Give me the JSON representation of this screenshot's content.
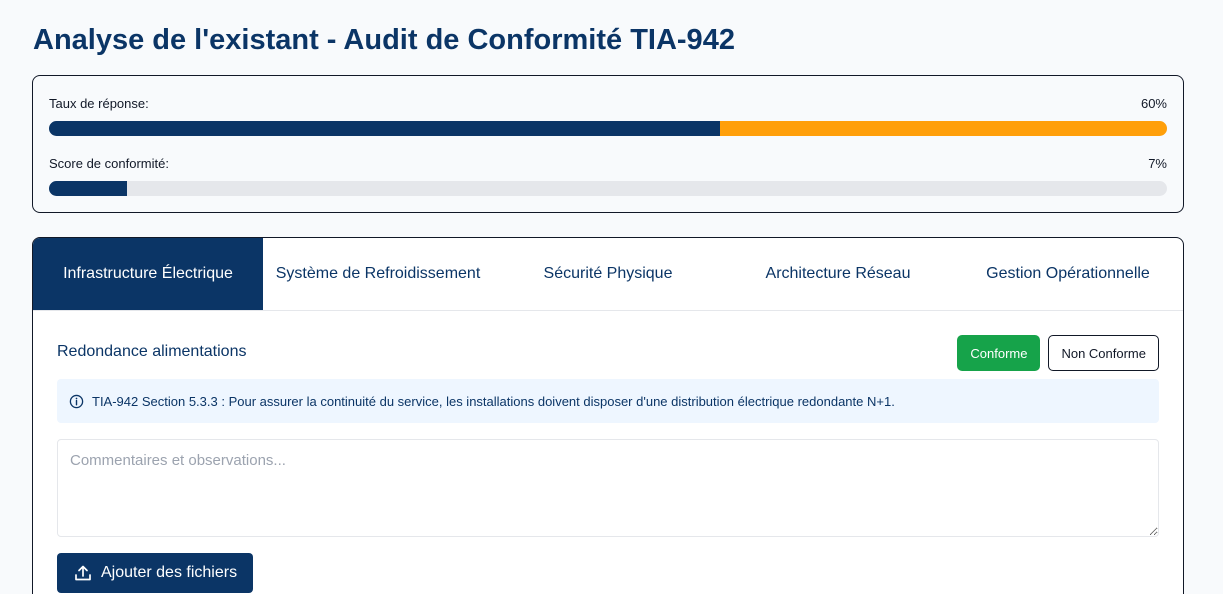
{
  "page": {
    "title": "Analyse de l'existant - Audit de Conformité TIA-942"
  },
  "stats": {
    "response_rate": {
      "label": "Taux de réponse:",
      "value_text": "60%",
      "value": 60
    },
    "compliance_score": {
      "label": "Score de conformité:",
      "value_text": "7%",
      "value": 7
    }
  },
  "tabs": [
    {
      "label": "Infrastructure Électrique",
      "active": true
    },
    {
      "label": "Système de Refroidissement",
      "active": false
    },
    {
      "label": "Sécurité Physique",
      "active": false
    },
    {
      "label": "Architecture Réseau",
      "active": false
    },
    {
      "label": "Gestion Opérationnelle",
      "active": false
    }
  ],
  "item": {
    "title": "Redondance alimentations",
    "conform_label": "Conforme",
    "nonconform_label": "Non Conforme",
    "info_text": "TIA-942 Section 5.3.3 : Pour assurer la continuité du service, les installations doivent disposer d'une distribution électrique redondante N+1.",
    "comment_placeholder": "Commentaires et observations...",
    "upload_label": "Ajouter des fichiers"
  },
  "colors": {
    "primary": "#0b3566",
    "accent": "#ff9f0a",
    "success": "#16a34a",
    "track": "#e5e7eb"
  },
  "icons": {
    "info": "info-circle-icon",
    "upload": "upload-icon"
  }
}
